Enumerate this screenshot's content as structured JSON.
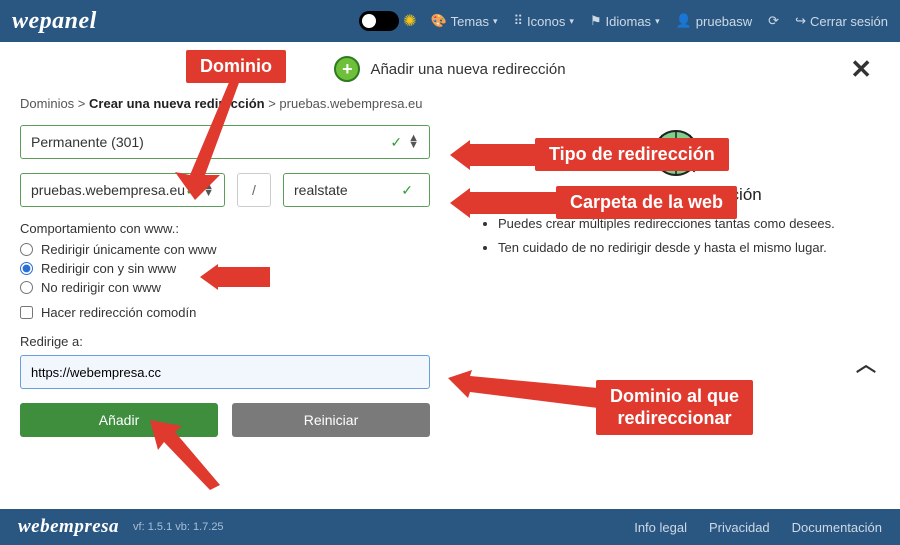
{
  "brand": "wepanel",
  "nav": {
    "temas": "Temas",
    "iconos": "Iconos",
    "idiomas": "Idiomas",
    "user": "pruebasw",
    "logout": "Cerrar sesión"
  },
  "header": {
    "title": "Añadir una nueva redirección"
  },
  "crumbs": {
    "a": "Dominios",
    "b": "Crear una nueva redirección",
    "c": "pruebas.webempresa.eu"
  },
  "form": {
    "redirect_type": "Permanente (301)",
    "domain": "pruebas.webempresa.eu",
    "slash": "/",
    "path": "realstate",
    "www_label": "Comportamiento con www.:",
    "www_opts": {
      "a": "Redirigir únicamente con www",
      "b": "Redirigir con y sin www",
      "c": "No redirigir con www"
    },
    "wildcard": "Hacer redirección comodín",
    "target_label": "Redirige a:",
    "target_value": "https://webempresa.cc",
    "btn_add": "Añadir",
    "btn_reset": "Reiniciar"
  },
  "help": {
    "title": "Crear una redirección",
    "li1": "Puedes crear múltiples redirecciones tantas como desees.",
    "li2": "Ten cuidado de no redirigir desde y hasta el mismo lugar."
  },
  "footer": {
    "brand": "webempresa",
    "version": "vf: 1.5.1 vb: 1.7.25",
    "info": "Info legal",
    "priv": "Privacidad",
    "docs": "Documentación"
  },
  "annotations": {
    "dominio": "Dominio",
    "tipo": "Tipo de redirección",
    "carpeta": "Carpeta de la web",
    "destino": "Dominio al que redireccionar"
  }
}
